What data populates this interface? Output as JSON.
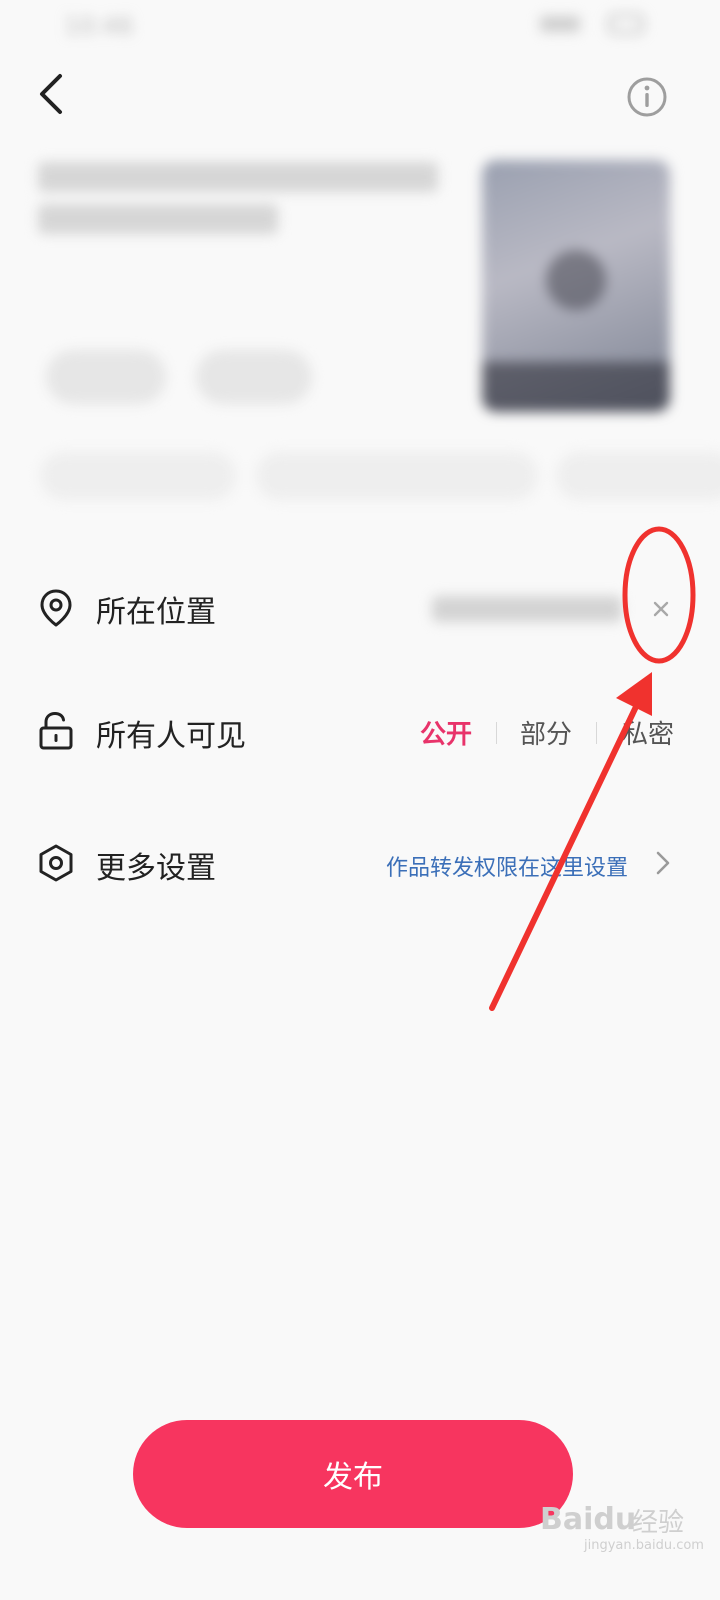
{
  "status_bar": {
    "time": "10:46"
  },
  "header": {
    "back_icon": "chevron-left-icon",
    "info_icon": "info-circle-icon"
  },
  "rows": {
    "location": {
      "label": "所在位置",
      "icon": "location-pin-icon",
      "clear_icon": "close-icon"
    },
    "visibility": {
      "label": "所有人可见",
      "icon": "unlock-icon",
      "options": [
        "公开",
        "部分",
        "私密"
      ],
      "selected": "公开"
    },
    "more": {
      "label": "更多设置",
      "icon": "hexagon-settings-icon",
      "link": "作品转发权限在这里设置"
    }
  },
  "publish": {
    "label": "发布"
  },
  "watermark": {
    "logo": "Baidu",
    "cn": "经验",
    "url": "jingyan.baidu.com"
  },
  "colors": {
    "accent": "#f7355f",
    "selected": "#e8336a",
    "link": "#3b6fb8",
    "annotation": "#f0322e"
  }
}
